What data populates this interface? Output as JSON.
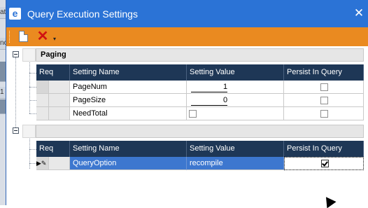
{
  "background": {
    "left_cells": [
      {
        "text": "at",
        "dark": false
      },
      {
        "text": "",
        "dark": false
      },
      {
        "text": "nc",
        "dark": false
      },
      {
        "text": "",
        "dark": true
      },
      {
        "text": "1",
        "dark": false
      },
      {
        "text": "",
        "dark": true
      }
    ]
  },
  "window": {
    "title": "Query Execution Settings",
    "app_icon_glyph": "e",
    "close_glyph": "✕",
    "accent_color": "#2b73d6",
    "toolbar_color": "#ea8a20"
  },
  "toolbar": {
    "new_icon": "new-document-icon",
    "delete_icon": "delete-x-icon",
    "delete_glyph": "✕",
    "dropdown_glyph": "▾"
  },
  "columns": [
    "Req",
    "Setting Name",
    "Setting Value",
    "Persist In Query"
  ],
  "groups": [
    {
      "title": "Paging",
      "rows": [
        {
          "name": "PageNum",
          "value": "1",
          "value_type": "number",
          "persist": false
        },
        {
          "name": "PageSize",
          "value": "0",
          "value_type": "number",
          "persist": false
        },
        {
          "name": "NeedTotal",
          "value": "",
          "value_type": "checkbox",
          "persist": false
        }
      ]
    },
    {
      "title": "",
      "rows": [
        {
          "name": "QueryOption",
          "value": "recompile",
          "value_type": "text",
          "persist": true,
          "selected": true,
          "indicator": "▶✎"
        }
      ]
    }
  ]
}
